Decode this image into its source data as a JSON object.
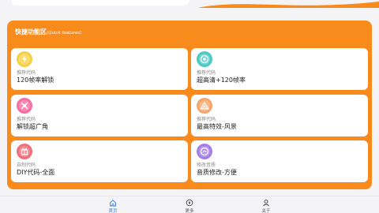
{
  "colors": {
    "accent": "#f98a1c",
    "nav_active": "#3b7ddd",
    "card_background": "#ffffff"
  },
  "panel": {
    "title": "快捷功能区",
    "subtitle": "(Quick features)"
  },
  "cards": [
    {
      "tag": "推荐代码",
      "name": "120帧率解锁",
      "icon": "bolt-icon",
      "color": "#f7cf45"
    },
    {
      "tag": "推荐代码",
      "name": "超高清+120帧率",
      "icon": "target-icon",
      "color": "#4ec9c2"
    },
    {
      "tag": "推荐代码",
      "name": "解锁超广角",
      "icon": "wide-angle-icon",
      "color": "#f66fa3"
    },
    {
      "tag": "推荐代码",
      "name": "最高特效-风景",
      "icon": "landscape-icon",
      "color": "#f6a46b"
    },
    {
      "tag": "自制代码",
      "name": "DIY代码-全面",
      "icon": "gift-icon",
      "color": "#f26f78"
    },
    {
      "tag": "修改音质",
      "name": "音质修改-方便",
      "icon": "sound-icon",
      "color": "#a27ee6"
    }
  ],
  "nav": [
    {
      "label": "首页",
      "icon": "home-icon",
      "active": true
    },
    {
      "label": "更多",
      "icon": "compass-icon",
      "active": false
    },
    {
      "label": "关于",
      "icon": "person-icon",
      "active": false
    }
  ]
}
